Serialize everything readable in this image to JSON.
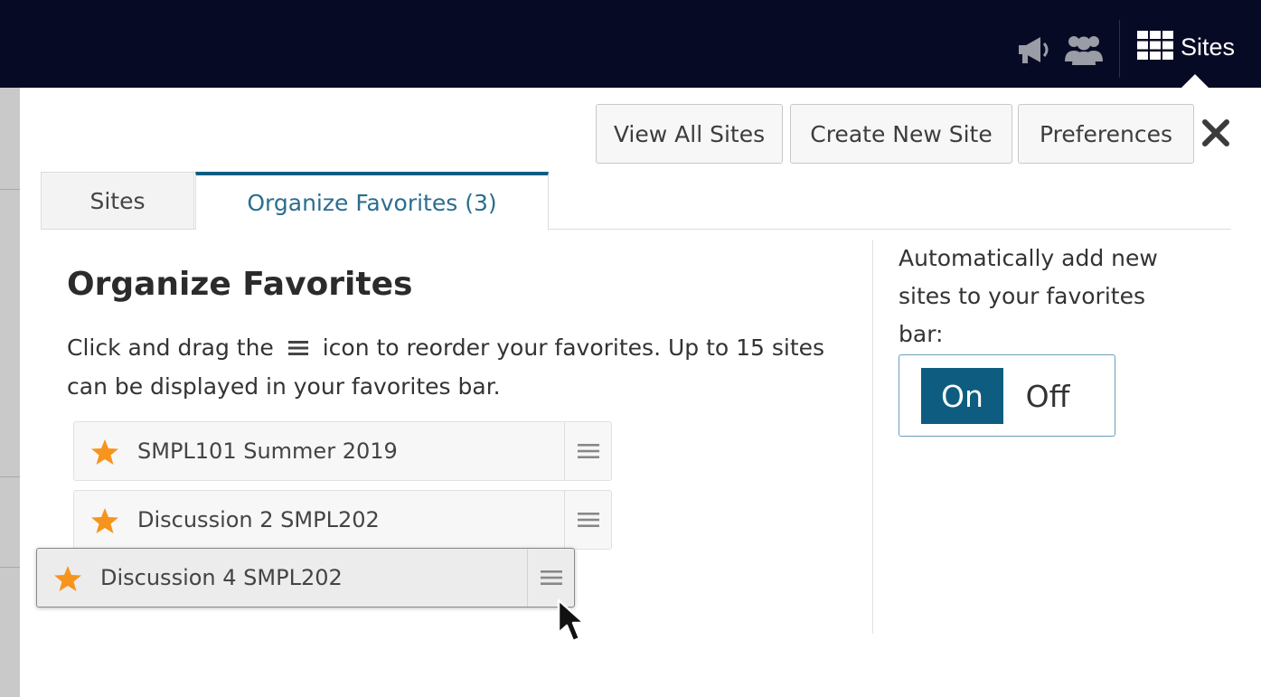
{
  "topbar": {
    "megaphone_icon": "megaphone-icon",
    "group_icon": "group-icon",
    "sites_label": "Sites"
  },
  "toolbar": {
    "view_all_sites": "View All Sites",
    "create_new_site": "Create New Site",
    "preferences": "Preferences"
  },
  "tabs": [
    {
      "label": "Sites",
      "active": false
    },
    {
      "label": "Organize Favorites (3)",
      "active": true
    }
  ],
  "main": {
    "heading": "Organize Favorites",
    "instruction_before": "Click and drag the",
    "instruction_after": "icon to reorder your favorites. Up to 15 sites can be displayed in your favorites bar.",
    "favorites": [
      {
        "name": "SMPL101 Summer 2019"
      },
      {
        "name": "Discussion 2 SMPL202"
      },
      {
        "name": "Discussion 4 SMPL202",
        "dragging": true
      }
    ]
  },
  "settings": {
    "auto_add_label": "Automatically add new sites to your favorites bar:",
    "toggle_on": "On",
    "toggle_off": "Off",
    "selected": "On"
  },
  "colors": {
    "topbar": "#070a24",
    "accent": "#0e5d80",
    "star": "#f7941d"
  }
}
